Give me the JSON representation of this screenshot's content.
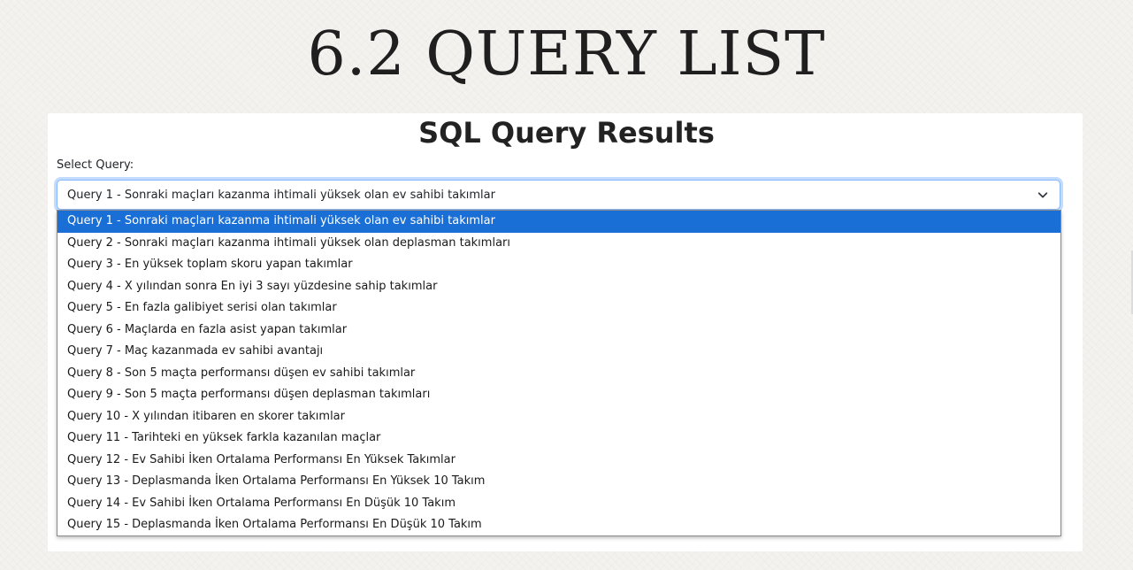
{
  "slide": {
    "title": "6.2 QUERY LIST"
  },
  "panel": {
    "heading": "SQL Query Results",
    "select_label": "Select Query:",
    "selected_value": "Query 1 - Sonraki maçları kazanma ihtimali yüksek olan ev sahibi takımlar",
    "selected_index": 0,
    "chevron_icon": "chevron-down-icon"
  },
  "options": [
    "Query 1 - Sonraki maçları kazanma ihtimali yüksek olan ev sahibi takımlar",
    "Query 2 - Sonraki maçları kazanma ihtimali yüksek olan deplasman takımları",
    "Query 3 - En yüksek toplam skoru yapan takımlar",
    "Query 4 - X yılından sonra En iyi 3 sayı yüzdesine sahip takımlar",
    "Query 5 - En fazla galibiyet serisi olan takımlar",
    "Query 6 - Maçlarda en fazla asist yapan takımlar",
    "Query 7 - Maç kazanmada ev sahibi avantajı",
    "Query 8 - Son 5 maçta performansı düşen ev sahibi takımlar",
    "Query 9 - Son 5 maçta performansı düşen deplasman takımları",
    "Query 10 - X yılından itibaren en skorer takımlar",
    "Query 11 - Tarihteki en yüksek farkla kazanılan maçlar",
    "Query 12 - Ev Sahibi İken Ortalama Performansı En Yüksek Takımlar",
    "Query 13 - Deplasmanda İken Ortalama Performansı En Yüksek 10 Takım",
    "Query 14 - Ev Sahibi İken Ortalama Performansı En Düşük 10 Takım",
    "Query 15 - Deplasmanda İken Ortalama Performansı En Düşük 10 Takım"
  ],
  "colors": {
    "highlight": "#1a6fd6",
    "focus_border": "#86b7fe"
  }
}
